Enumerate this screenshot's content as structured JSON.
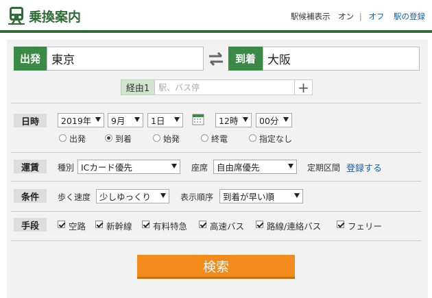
{
  "header": {
    "title": "乗換案内",
    "station_display_label": "駅候補表示",
    "on_label": "オン",
    "separator": "|",
    "off_label": "オフ",
    "register_label": "駅の登録"
  },
  "route": {
    "departure_tag": "出発",
    "departure_value": "東京",
    "arrival_tag": "到着",
    "arrival_value": "大阪",
    "via_tag": "経由1",
    "via_placeholder": "駅、バス停",
    "via_add": "+"
  },
  "datetime": {
    "label": "日時",
    "year": "2019年",
    "month": "9月",
    "day": "1日",
    "hour": "12時",
    "minute": "00分",
    "options": [
      "出発",
      "到着",
      "始発",
      "終電",
      "指定なし"
    ],
    "selected_option": "到着"
  },
  "fare": {
    "label": "運賃",
    "type_label": "種別",
    "type_value": "ICカード優先",
    "seat_label": "座席",
    "seat_value": "自由席優先",
    "commuter_label": "定期区間",
    "commuter_link": "登録する"
  },
  "conditions": {
    "label": "条件",
    "walk_label": "歩く速度",
    "walk_value": "少しゆっくり",
    "order_label": "表示順序",
    "order_value": "到着が早い順"
  },
  "means": {
    "label": "手段",
    "items": [
      "空路",
      "新幹線",
      "有料特急",
      "高速バス",
      "路線/連絡バス",
      "フェリー"
    ]
  },
  "search_button": "検索",
  "colors": {
    "brand_green": "#3a8a45",
    "header_green": "#2e6b35",
    "search_orange": "#f28a1c",
    "link_blue": "#1a5ea8"
  }
}
